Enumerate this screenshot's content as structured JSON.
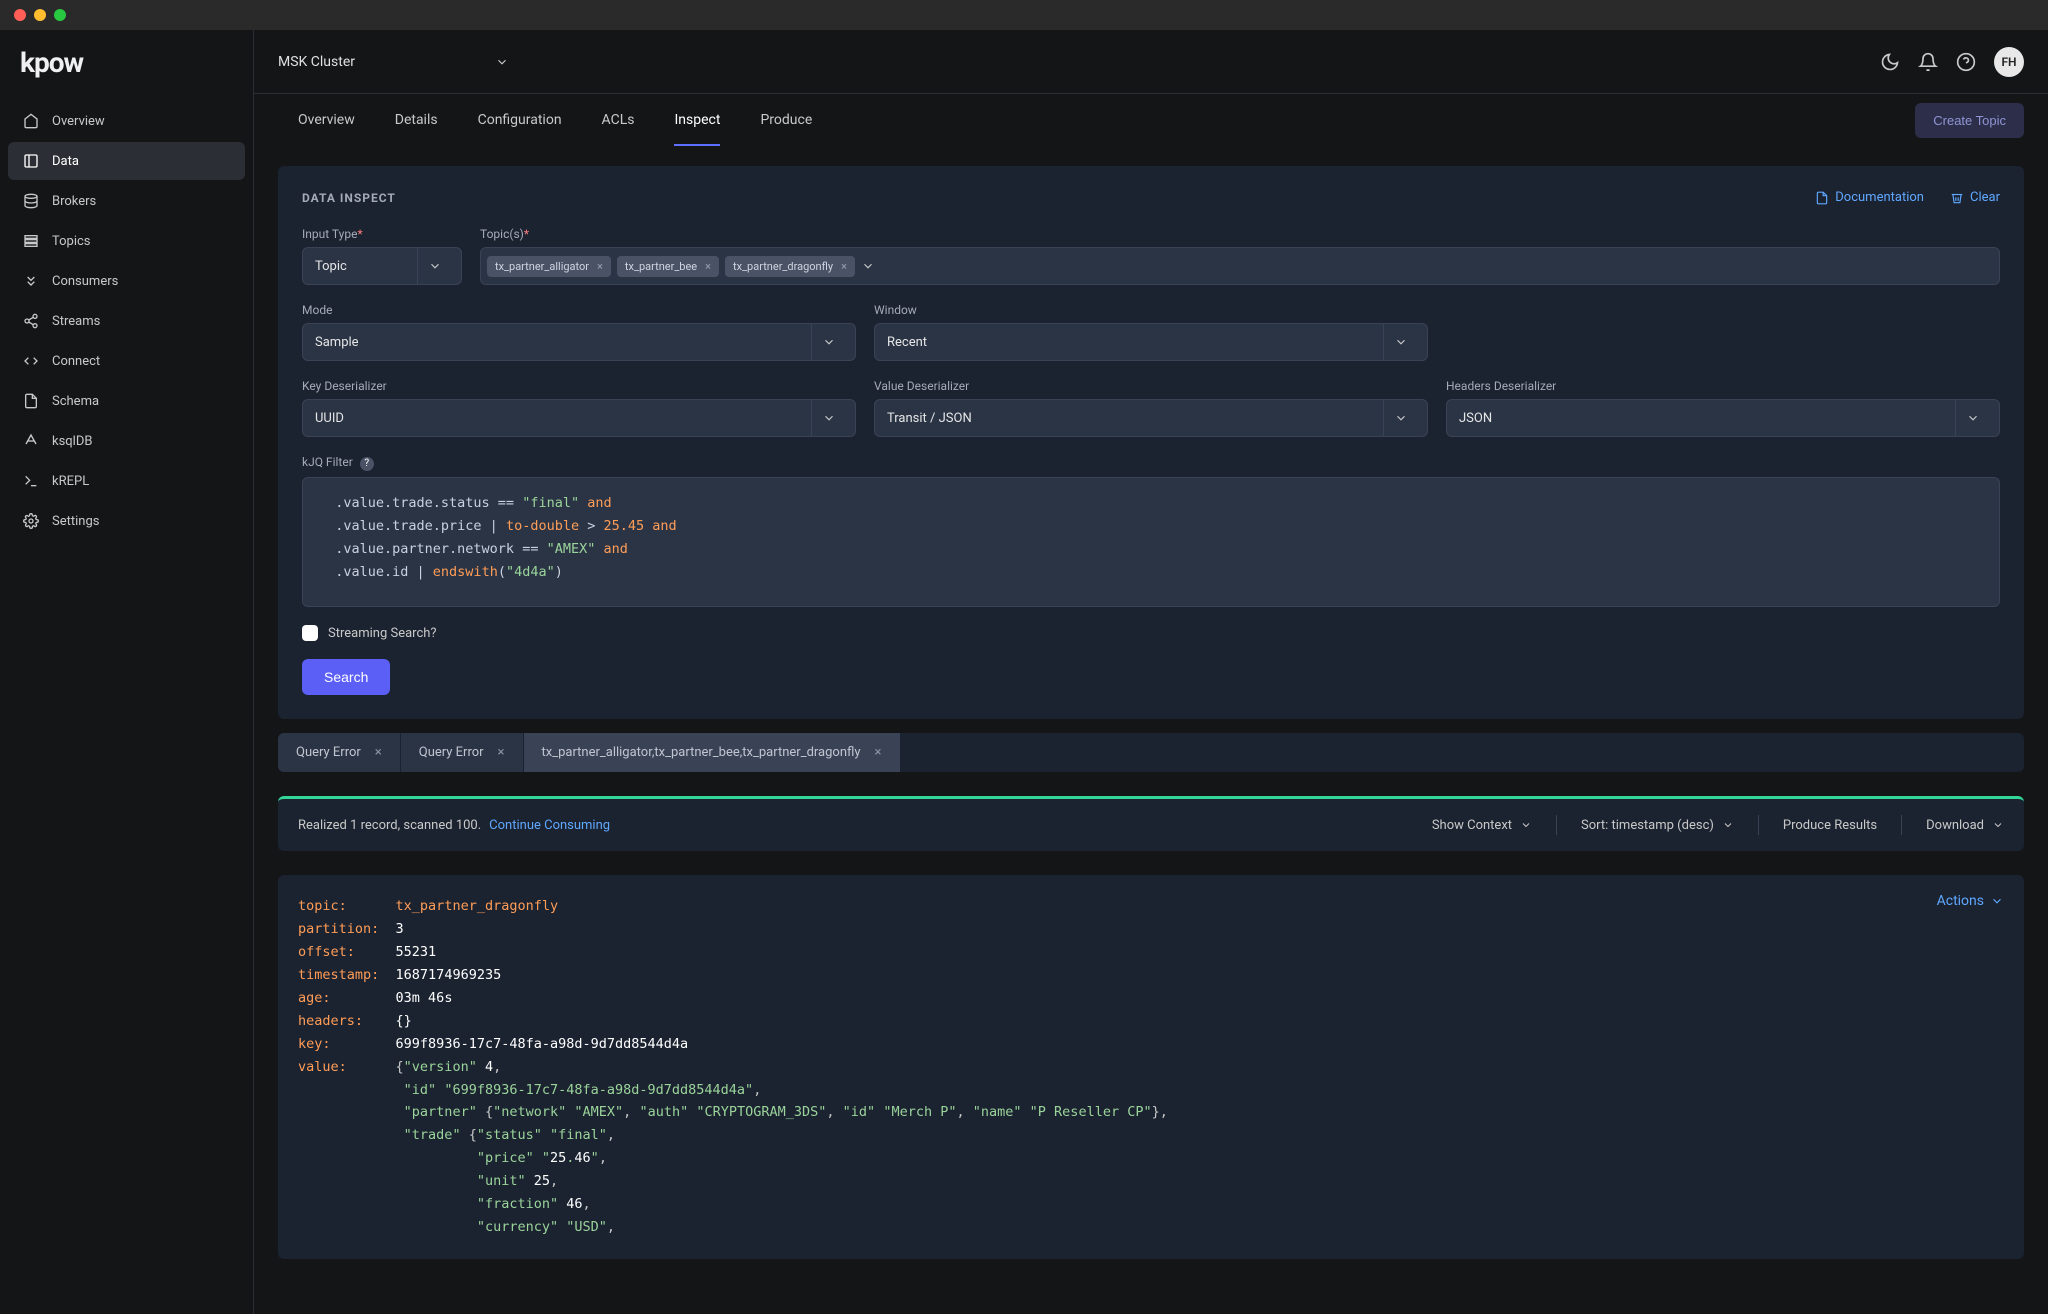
{
  "logo": "kpow",
  "cluster_selector": "MSK Cluster",
  "avatar_initials": "FH",
  "sidebar": {
    "items": [
      {
        "label": "Overview",
        "icon": "home-icon"
      },
      {
        "label": "Data",
        "icon": "data-icon",
        "active": true
      },
      {
        "label": "Brokers",
        "icon": "brokers-icon"
      },
      {
        "label": "Topics",
        "icon": "topics-icon"
      },
      {
        "label": "Consumers",
        "icon": "consumers-icon"
      },
      {
        "label": "Streams",
        "icon": "streams-icon"
      },
      {
        "label": "Connect",
        "icon": "connect-icon"
      },
      {
        "label": "Schema",
        "icon": "schema-icon"
      },
      {
        "label": "ksqlDB",
        "icon": "ksqldb-icon"
      },
      {
        "label": "kREPL",
        "icon": "krepl-icon"
      },
      {
        "label": "Settings",
        "icon": "settings-icon"
      }
    ]
  },
  "tabs": [
    "Overview",
    "Details",
    "Configuration",
    "ACLs",
    "Inspect",
    "Produce"
  ],
  "active_tab": "Inspect",
  "create_topic_btn": "Create Topic",
  "inspect": {
    "title": "DATA INSPECT",
    "doc_link": "Documentation",
    "clear_link": "Clear",
    "input_type_label": "Input Type",
    "input_type_value": "Topic",
    "topics_label": "Topic(s)",
    "topics": [
      "tx_partner_alligator",
      "tx_partner_bee",
      "tx_partner_dragonfly"
    ],
    "mode_label": "Mode",
    "mode_value": "Sample",
    "window_label": "Window",
    "window_value": "Recent",
    "key_deser_label": "Key Deserializer",
    "key_deser_value": "UUID",
    "value_deser_label": "Value Deserializer",
    "value_deser_value": "Transit / JSON",
    "headers_deser_label": "Headers Deserializer",
    "headers_deser_value": "JSON",
    "kjq_label": "kJQ Filter",
    "kjq_lines": [
      ".value.trade.status == \"final\" and",
      ".value.trade.price | to-double > 25.45 and",
      ".value.partner.network == \"AMEX\" and",
      ".value.id | endswith(\"4d4a\")"
    ],
    "streaming_label": "Streaming Search?",
    "search_btn": "Search"
  },
  "query_tabs": [
    {
      "label": "Query Error"
    },
    {
      "label": "Query Error"
    },
    {
      "label": "tx_partner_alligator,tx_partner_bee,tx_partner_dragonfly",
      "active": true
    }
  ],
  "result_bar": {
    "text": "Realized 1 record, scanned 100.",
    "continue": "Continue Consuming",
    "show_context": "Show Context",
    "sort": "Sort: timestamp (desc)",
    "produce": "Produce Results",
    "download": "Download"
  },
  "record": {
    "actions_label": "Actions",
    "fields": {
      "topic": "tx_partner_dragonfly",
      "partition": "3",
      "offset": "55231",
      "timestamp": "1687174969235",
      "age": "03m 46s",
      "headers": "{}",
      "key": "699f8936-17c7-48fa-a98d-9d7dd8544d4a"
    },
    "value_lines": [
      "{\"version\" 4,",
      " \"id\" \"699f8936-17c7-48fa-a98d-9d7dd8544d4a\",",
      " \"partner\" {\"network\" \"AMEX\", \"auth\" \"CRYPTOGRAM_3DS\", \"id\" \"Merch P\", \"name\" \"P Reseller CP\"},",
      " \"trade\" {\"status\" \"final\",",
      "          \"price\" \"25.46\",",
      "          \"unit\" 25,",
      "          \"fraction\" 46,",
      "          \"currency\" \"USD\","
    ]
  }
}
